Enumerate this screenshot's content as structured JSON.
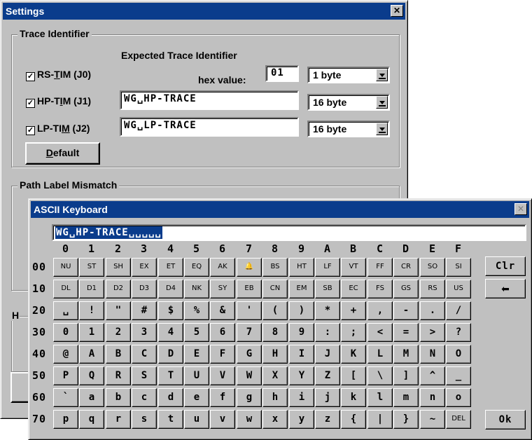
{
  "settings": {
    "title": "Settings",
    "close_glyph": "✕",
    "trace_group": {
      "label": "Trace Identifier",
      "expected_label": "Expected Trace Identifier",
      "hex_label": "hex value:",
      "hex_value": "01",
      "rows": [
        {
          "check": "✓",
          "label_pre": "RS-",
          "label_u": "T",
          "label_post": "IM (J0)",
          "value": "",
          "size": "1 byte"
        },
        {
          "check": "✓",
          "label_pre": "HP-T",
          "label_u": "I",
          "label_post": "M (J1)",
          "value": "WG␣HP-TRACE",
          "size": "16 byte"
        },
        {
          "check": "✓",
          "label_pre": "LP-TI",
          "label_u": "M",
          "label_post": " (J2)",
          "value": "WG␣LP-TRACE",
          "size": "16 byte"
        }
      ],
      "default_button_u": "D",
      "default_button_rest": "efault"
    },
    "path_group": {
      "label": "Path Label Mismatch"
    },
    "partial_group_label": "H"
  },
  "keyboard": {
    "title": "ASCII Keyboard",
    "close_glyph": "✕",
    "input_value": "WG␣HP-TRACE␣␣␣␣␣",
    "columns": [
      "0",
      "1",
      "2",
      "3",
      "4",
      "5",
      "6",
      "7",
      "8",
      "9",
      "A",
      "B",
      "C",
      "D",
      "E",
      "F"
    ],
    "rows": [
      {
        "label": "00",
        "keys": [
          "NU",
          "ST",
          "SH",
          "EX",
          "ET",
          "EQ",
          "AK",
          "🔔",
          "BS",
          "HT",
          "LF",
          "VT",
          "FF",
          "CR",
          "SO",
          "SI"
        ]
      },
      {
        "label": "10",
        "keys": [
          "DL",
          "D1",
          "D2",
          "D3",
          "D4",
          "NK",
          "SY",
          "EB",
          "CN",
          "EM",
          "SB",
          "EC",
          "FS",
          "GS",
          "RS",
          "US"
        ]
      },
      {
        "label": "20",
        "keys": [
          "␣",
          "!",
          "\"",
          "#",
          "$",
          "%",
          "&",
          "'",
          "(",
          ")",
          "*",
          "+",
          ",",
          "-",
          ".",
          "/"
        ]
      },
      {
        "label": "30",
        "keys": [
          "0",
          "1",
          "2",
          "3",
          "4",
          "5",
          "6",
          "7",
          "8",
          "9",
          ":",
          ";",
          "<",
          "=",
          ">",
          "?"
        ]
      },
      {
        "label": "40",
        "keys": [
          "@",
          "A",
          "B",
          "C",
          "D",
          "E",
          "F",
          "G",
          "H",
          "I",
          "J",
          "K",
          "L",
          "M",
          "N",
          "O"
        ]
      },
      {
        "label": "50",
        "keys": [
          "P",
          "Q",
          "R",
          "S",
          "T",
          "U",
          "V",
          "W",
          "X",
          "Y",
          "Z",
          "[",
          "\\",
          "]",
          "^",
          "_"
        ]
      },
      {
        "label": "60",
        "keys": [
          "`",
          "a",
          "b",
          "c",
          "d",
          "e",
          "f",
          "g",
          "h",
          "i",
          "j",
          "k",
          "l",
          "m",
          "n",
          "o"
        ]
      },
      {
        "label": "70",
        "keys": [
          "p",
          "q",
          "r",
          "s",
          "t",
          "u",
          "v",
          "w",
          "x",
          "y",
          "z",
          "{",
          "|",
          "}",
          "~",
          "DEL"
        ]
      }
    ],
    "clr_label": "Clr",
    "backspace_glyph": "⬅",
    "ok_label": "Ok"
  }
}
